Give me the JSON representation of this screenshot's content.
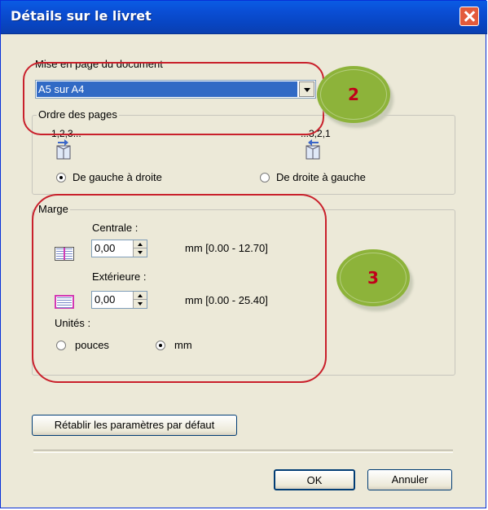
{
  "window": {
    "title": "Détails sur le livret"
  },
  "layout_group": {
    "label": "Mise en page du document",
    "selected_value": "A5 sur A4"
  },
  "page_order": {
    "label": "Ordre des pages",
    "left_caption": "1,2,3...",
    "right_caption": "...3,2,1",
    "left_option": "De gauche à droite",
    "right_option": "De droite à gauche",
    "selected": "De gauche à droite"
  },
  "margin": {
    "label": "Marge",
    "central_label": "Centrale :",
    "central_value": "0,00",
    "central_range": "mm [0.00 - 12.70]",
    "outer_label": "Extérieure :",
    "outer_value": "0,00",
    "outer_range": "mm [0.00 - 25.40]",
    "units_label": "Unités :",
    "unit_inches": "pouces",
    "unit_mm": "mm",
    "selected_unit": "mm"
  },
  "buttons": {
    "reset": "Rétablir les paramètres par défaut",
    "ok": "OK",
    "cancel": "Annuler"
  },
  "annotations": {
    "badge_2": "2",
    "badge_3": "3",
    "callout_color": "#c9202b",
    "badge_color": "#8db33a"
  }
}
